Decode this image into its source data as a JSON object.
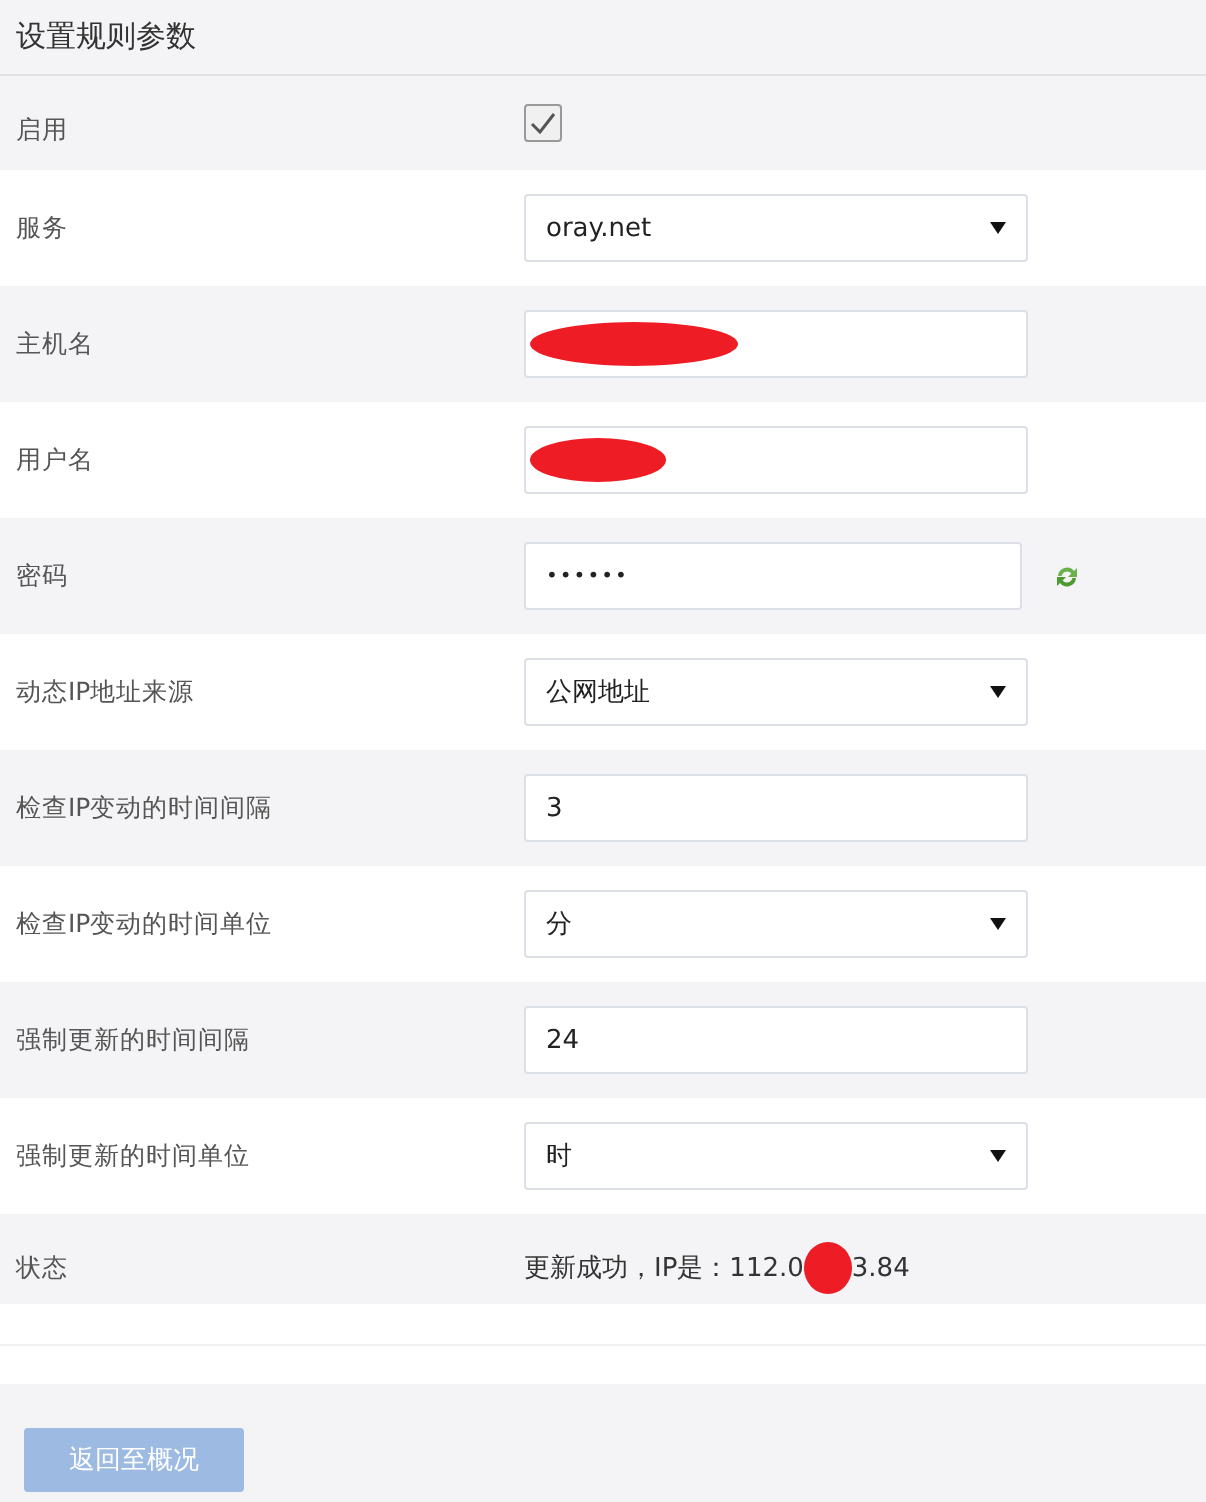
{
  "title": "设置规则参数",
  "rows": [
    {
      "label": "启用",
      "kind": "checkbox",
      "checked": true
    },
    {
      "label": "服务",
      "kind": "select",
      "value": "oray.net"
    },
    {
      "label": "主机名",
      "kind": "text",
      "redacted": true
    },
    {
      "label": "用户名",
      "kind": "text",
      "redacted": true
    },
    {
      "label": "密码",
      "kind": "password",
      "value": "••••••"
    },
    {
      "label": "动态IP地址来源",
      "kind": "select",
      "value": "公网地址"
    },
    {
      "label": "检查IP变动的时间间隔",
      "kind": "text",
      "value": "3"
    },
    {
      "label": "检查IP变动的时间单位",
      "kind": "select",
      "value": "分"
    },
    {
      "label": "强制更新的时间间隔",
      "kind": "text",
      "value": "24"
    },
    {
      "label": "强制更新的时间单位",
      "kind": "select",
      "value": "时"
    },
    {
      "label": "状态",
      "kind": "status",
      "text_before": "更新成功，IP是：112.0",
      "text_after": "3.84",
      "redacted": true
    }
  ],
  "back_button": {
    "label": "返回至概况",
    "disabled": true
  }
}
